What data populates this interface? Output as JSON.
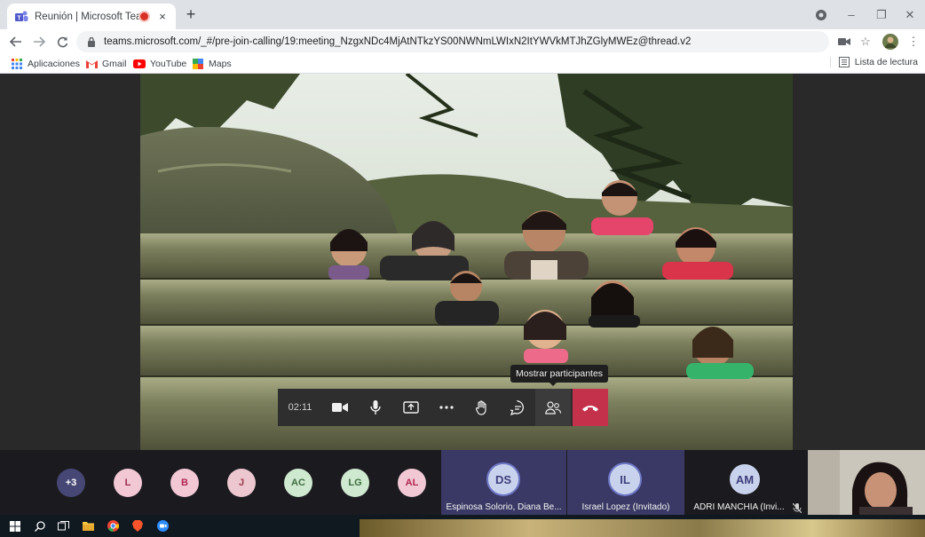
{
  "browser": {
    "tab_title": "Reunión | Microsoft Teams",
    "tab_close": "×",
    "new_tab": "+",
    "url": "teams.microsoft.com/_#/pre-join-calling/19:meeting_NzgxNDc4MjAtNTkzYS00NWNmLWIxN2ItYWVkMTJhZGlyMWEz@thread.v2",
    "window_controls": {
      "minimize": "–",
      "restore": "❐",
      "close": "✕"
    }
  },
  "bookmarks": {
    "items": [
      {
        "label": "Aplicaciones",
        "icon": "apps-grid-icon"
      },
      {
        "label": "Gmail",
        "icon": "gmail-icon"
      },
      {
        "label": "YouTube",
        "icon": "youtube-icon"
      },
      {
        "label": "Maps",
        "icon": "maps-icon"
      }
    ],
    "reading_list": "Lista de lectura"
  },
  "call": {
    "elapsed": "02:11",
    "tooltip": "Mostrar participantes",
    "controls": [
      "camera-icon",
      "microphone-icon",
      "share-screen-icon",
      "more-options-icon",
      "raise-hand-icon",
      "chat-icon",
      "participants-icon"
    ],
    "hangup_icon": "hang-up-icon"
  },
  "participants": {
    "more": "+3",
    "avatars": [
      {
        "initials": "L",
        "bg": "#f1c8d4",
        "fg": "#9c2a4e"
      },
      {
        "initials": "B",
        "bg": "#f1c8d4",
        "fg": "#b3264f"
      },
      {
        "initials": "J",
        "bg": "#ecc7cf",
        "fg": "#9a3b4d"
      },
      {
        "initials": "AC",
        "bg": "#cfe8d0",
        "fg": "#3f6e3f"
      },
      {
        "initials": "LG",
        "bg": "#cfe8d0",
        "fg": "#3f6e3f"
      },
      {
        "initials": "AL",
        "bg": "#f1c8d4",
        "fg": "#b3264f"
      }
    ],
    "tiles": [
      {
        "initials": "DS",
        "name": "Espinosa Solorio, Diana Be..."
      },
      {
        "initials": "IL",
        "name": "Israel Lopez (Invitado)"
      },
      {
        "initials": "AM",
        "name": "ADRI MANCHIA (Invi..."
      }
    ]
  },
  "colors": {
    "accent": "#6264a7",
    "hangup": "#c4314b",
    "more_bg": "#464775"
  }
}
